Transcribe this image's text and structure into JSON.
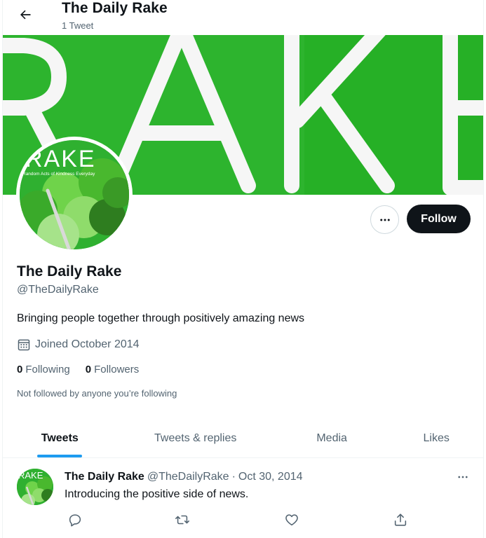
{
  "header": {
    "title": "The Daily Rake",
    "subtitle": "1 Tweet"
  },
  "banner": {
    "text": "RAKE",
    "colors": {
      "background": "#2db42e",
      "letters": "#ffffff"
    }
  },
  "avatar": {
    "brand_text": "RAKE",
    "tagline": "Random Acts of Kindness Everyday"
  },
  "actions": {
    "more_icon": "more-dots-icon",
    "follow_label": "Follow"
  },
  "profile": {
    "name": "The Daily Rake",
    "handle": "@TheDailyRake",
    "bio": "Bringing people together through positively amazing news",
    "joined": "Joined October 2014",
    "following_count": "0",
    "following_label": "Following",
    "followers_count": "0",
    "followers_label": "Followers",
    "not_followed": "Not followed by anyone you’re following"
  },
  "tabs": [
    {
      "label": "Tweets",
      "active": true
    },
    {
      "label": "Tweets & replies",
      "active": false
    },
    {
      "label": "Media",
      "active": false
    },
    {
      "label": "Likes",
      "active": false
    }
  ],
  "tweet": {
    "name": "The Daily Rake",
    "handle": "@TheDailyRake",
    "separator": "·",
    "date": "Oct 30, 2014",
    "text": "Introducing the positive side of news.",
    "avatar_text": "RAKE",
    "actions": [
      "reply-icon",
      "retweet-icon",
      "like-icon",
      "share-icon"
    ]
  },
  "colors": {
    "accent": "#1d9bf0",
    "follow_bg": "#0f1419",
    "secondary_text": "#536471"
  }
}
